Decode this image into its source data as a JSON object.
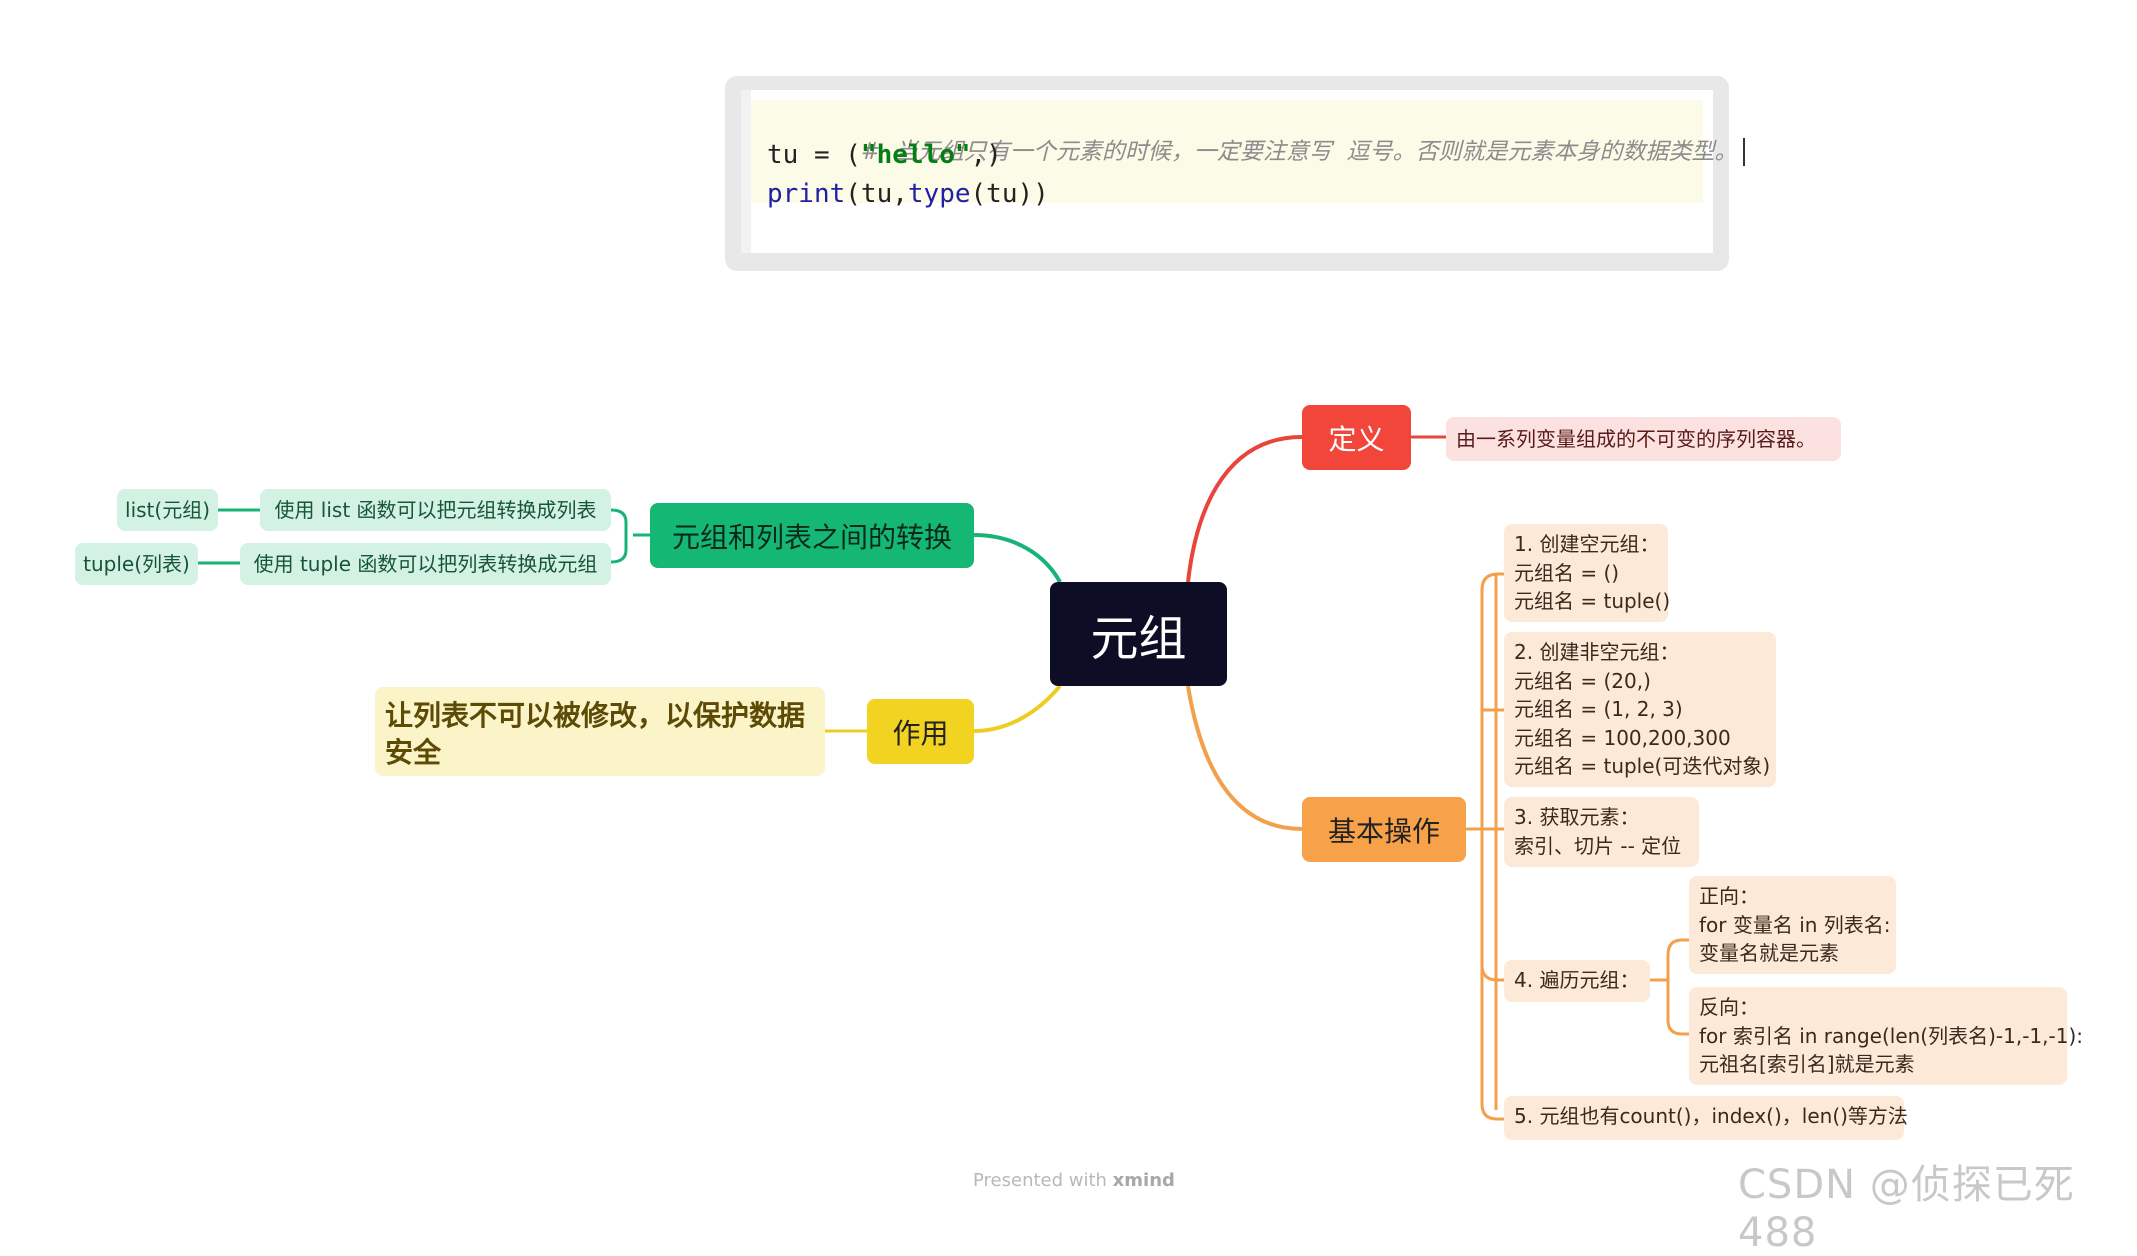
{
  "code": {
    "comment": "#  当元组只有一个元素的时候，一定要注意写  逗号。否则就是元素本身的数据类型。",
    "line2_pre": "tu = (",
    "line2_str": "\"hello\"",
    "line2_post": ",)",
    "line3_fn1": "print",
    "line3_mid": "(tu,",
    "line3_fn2": "type",
    "line3_end": "(tu))"
  },
  "mindmap": {
    "central": "元组",
    "definition": {
      "label": "定义",
      "text": "由一系列变量组成的不可变的序列容器。"
    },
    "operations": {
      "label": "基本操作",
      "items": [
        "1. 创建空元组：\n元组名 = ()\n元组名 = tuple()",
        "2. 创建非空元组：\n元组名 = (20,)\n元组名 = (1, 2, 3)\n元组名 = 100,200,300\n元组名 = tuple(可迭代对象)",
        "3. 获取元素：\n索引、切片 -- 定位",
        "4. 遍历元组：",
        "5. 元组也有count()，index()，len()等方法"
      ],
      "traverse": [
        "正向：\nfor 变量名 in 列表名:\n变量名就是元素",
        "反向：\nfor 索引名 in range(len(列表名)-1,-1,-1):\n元祖名[索引名]就是元素"
      ]
    },
    "usage": {
      "label": "作用",
      "text": "让列表不可以被修改，以保护数据安全"
    },
    "conversion": {
      "label": "元组和列表之间的转换",
      "items": [
        {
          "desc": "使用 list 函数可以把元组转换成列表",
          "code": "list(元组)"
        },
        {
          "desc": "使用 tuple 函数可以把列表转换成元组",
          "code": "tuple(列表)"
        }
      ]
    }
  },
  "footer": {
    "prefix": "Presented with ",
    "brand": "xmind"
  },
  "watermark": "CSDN @侦探已死488",
  "colors": {
    "central": "#0d0d26",
    "definition": "#f2463b",
    "operations": "#f7a249",
    "usage": "#f2d321",
    "conversion": "#14b874"
  }
}
